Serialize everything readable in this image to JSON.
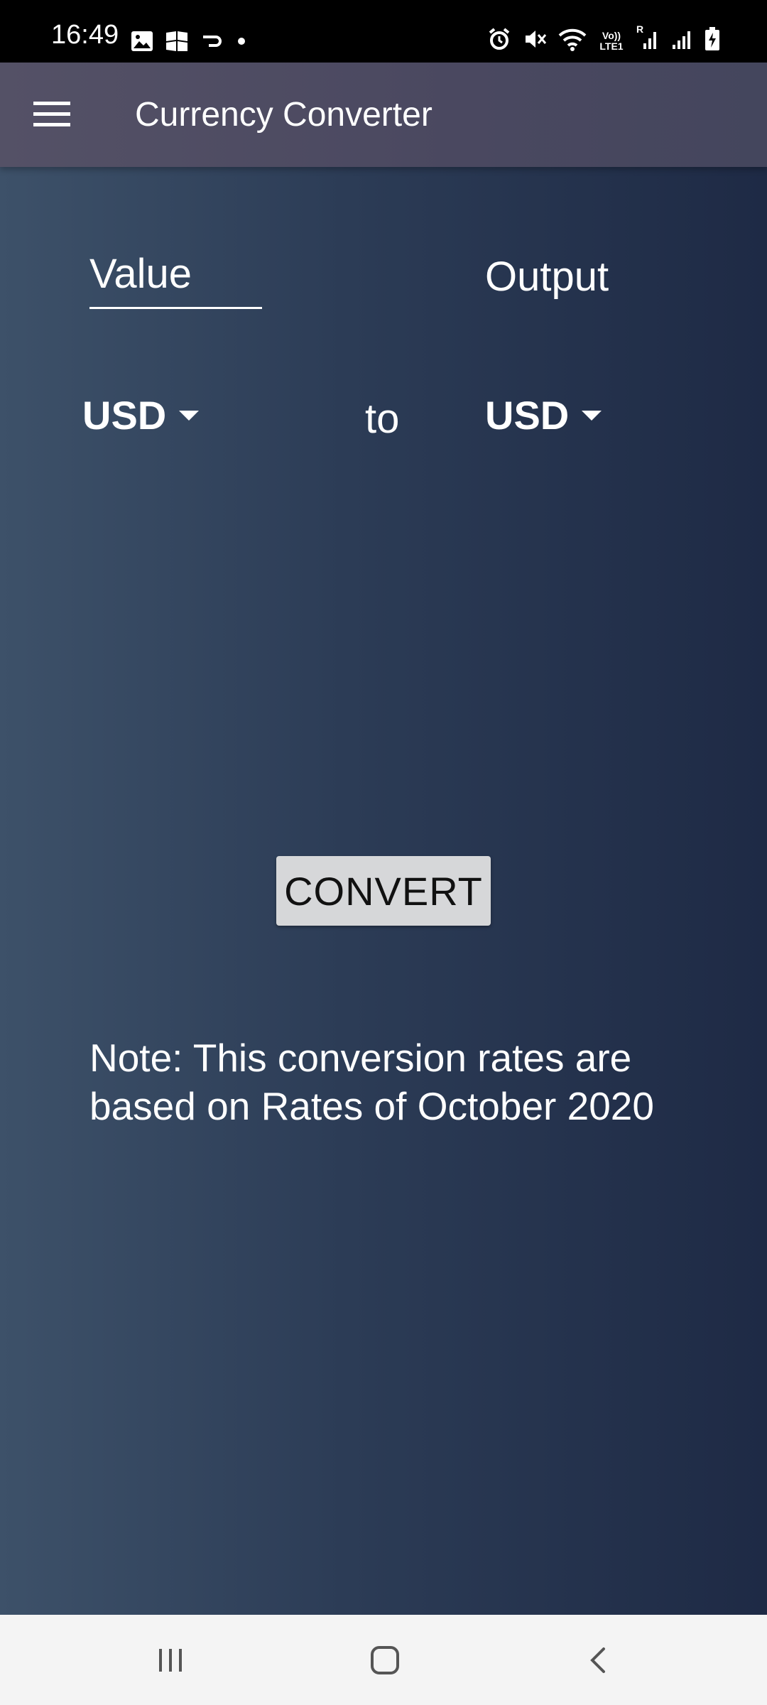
{
  "status_bar": {
    "time": "16:49",
    "left_icons": [
      "image-icon",
      "puzzle-icon",
      "cast-icon",
      "dot-icon"
    ],
    "right_icons": [
      "alarm-icon",
      "mute-icon",
      "wifi-icon",
      "volte-icon",
      "signal-icon",
      "signal-icon-2",
      "battery-charging-icon"
    ],
    "volte_text": "Vo)) LTE1",
    "roaming_text": "R"
  },
  "app_bar": {
    "title": "Currency Converter",
    "menu_icon": "hamburger-menu-icon"
  },
  "converter": {
    "value_placeholder": "Value",
    "output_label": "Output",
    "from_currency": "USD",
    "to_word": "to",
    "to_currency": "USD",
    "convert_label": "CONVERT",
    "note": "Note: This conversion rates are based on Rates of October 2020"
  },
  "nav_bar": {
    "recents_icon": "recents-icon",
    "home_icon": "home-icon",
    "back_icon": "back-icon"
  },
  "colors": {
    "app_bar": "#4d4b61",
    "content_start": "#3d5169",
    "content_end": "#1e2a45",
    "button_bg": "#d6d7d9",
    "nav_bar": "#f4f4f4"
  }
}
